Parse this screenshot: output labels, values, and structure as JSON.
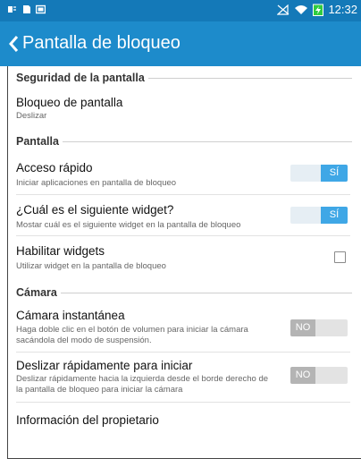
{
  "status_bar": {
    "time": "12:32",
    "left_icons": [
      "usb-debug-icon",
      "sd-card-icon",
      "screenshot-icon"
    ],
    "right_icons": [
      "signal-muted-icon",
      "wifi-icon",
      "battery-charging-icon"
    ]
  },
  "app_bar": {
    "title": "Pantalla de bloqueo",
    "back_icon": "chevron-left-icon"
  },
  "sections": {
    "security": {
      "header": "Seguridad de la pantalla"
    },
    "screen": {
      "header": "Pantalla"
    },
    "camera": {
      "header": "Cámara"
    }
  },
  "items": {
    "screen_lock": {
      "title": "Bloqueo de pantalla",
      "subtitle": "Deslizar"
    },
    "quick_access": {
      "title": "Acceso rápido",
      "subtitle": "Iniciar aplicaciones en pantalla de bloqueo",
      "toggle_label": "SÍ",
      "enabled": true
    },
    "next_widget": {
      "title": "¿Cuál es el siguiente widget?",
      "subtitle": "Mostar cuál es el siguiente widget en la pantalla de bloqueo",
      "toggle_label": "SÍ",
      "enabled": true
    },
    "enable_widgets": {
      "title": "Habilitar widgets",
      "subtitle": "Utilizar widget en la pantalla de bloqueo",
      "checked": false
    },
    "instant_camera": {
      "title": "Cámara instantánea",
      "subtitle_line1": "Haga doble clic en el botón de volumen para iniciar la cámara",
      "subtitle_line2": "sacándola del modo de suspensión.",
      "toggle_label": "NO",
      "enabled": false
    },
    "swipe_launch": {
      "title": "Deslizar rápidamente para iniciar",
      "subtitle_line1": "Deslizar rápidamente hacia la izquierda desde el borde derecho de",
      "subtitle_line2": "la pantalla de bloqueo para iniciar la cámara",
      "toggle_label": "NO",
      "enabled": false
    },
    "owner_info": {
      "title": "Información del propietario"
    }
  },
  "colors": {
    "status_bar": "#1479b8",
    "app_bar": "#1d8bcb",
    "toggle_on": "#3fa7e6",
    "toggle_off": "#b4b4b4"
  }
}
